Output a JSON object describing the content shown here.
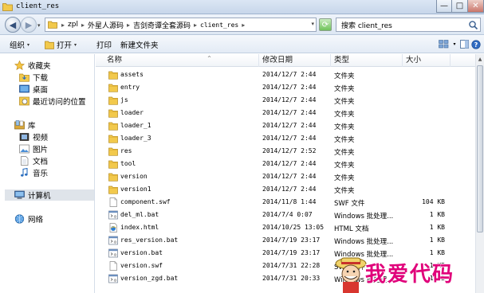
{
  "window": {
    "title": "client_res",
    "minimize": "—",
    "maximize": "□",
    "close": "✕"
  },
  "address": {
    "back": "◀",
    "forward": "▶",
    "crumbs": [
      "zpl",
      "外星人源码",
      "吉剑奇谭全套源码",
      "client_res"
    ],
    "separator": "▸",
    "dropdown": "▾",
    "refresh": "⟳"
  },
  "search": {
    "value": "搜索 client_res"
  },
  "toolbar": {
    "organize": "组织",
    "open": "打开",
    "print": "打印",
    "new_folder": "新建文件夹",
    "dropdown": "▾"
  },
  "sidebar": {
    "favorites": "收藏夹",
    "downloads": "下载",
    "desktop": "桌面",
    "recent": "最近访问的位置",
    "libraries": "库",
    "videos": "视频",
    "pictures": "图片",
    "documents": "文档",
    "music": "音乐",
    "computer": "计算机",
    "network": "网络"
  },
  "columns": {
    "name": "名称",
    "sort": "^",
    "date": "修改日期",
    "type": "类型",
    "size": "大小"
  },
  "files": [
    {
      "name": "assets",
      "date": "2014/12/7 2:44",
      "type": "文件夹",
      "size": "",
      "icon": "folder-icon"
    },
    {
      "name": "entry",
      "date": "2014/12/7 2:44",
      "type": "文件夹",
      "size": "",
      "icon": "folder-icon"
    },
    {
      "name": "js",
      "date": "2014/12/7 2:44",
      "type": "文件夹",
      "size": "",
      "icon": "folder-icon"
    },
    {
      "name": "loader",
      "date": "2014/12/7 2:44",
      "type": "文件夹",
      "size": "",
      "icon": "folder-icon"
    },
    {
      "name": "loader_1",
      "date": "2014/12/7 2:44",
      "type": "文件夹",
      "size": "",
      "icon": "folder-icon"
    },
    {
      "name": "loader_3",
      "date": "2014/12/7 2:44",
      "type": "文件夹",
      "size": "",
      "icon": "folder-icon"
    },
    {
      "name": "res",
      "date": "2014/12/7 2:52",
      "type": "文件夹",
      "size": "",
      "icon": "folder-icon"
    },
    {
      "name": "tool",
      "date": "2014/12/7 2:44",
      "type": "文件夹",
      "size": "",
      "icon": "folder-icon"
    },
    {
      "name": "version",
      "date": "2014/12/7 2:44",
      "type": "文件夹",
      "size": "",
      "icon": "folder-icon"
    },
    {
      "name": "version1",
      "date": "2014/12/7 2:44",
      "type": "文件夹",
      "size": "",
      "icon": "folder-icon"
    },
    {
      "name": "component.swf",
      "date": "2014/11/8 1:44",
      "type": "SWF 文件",
      "size": "104 KB",
      "icon": "swf-file-icon"
    },
    {
      "name": "del_ml.bat",
      "date": "2014/7/4 0:07",
      "type": "Windows 批处理...",
      "size": "1 KB",
      "icon": "bat-file-icon"
    },
    {
      "name": "index.html",
      "date": "2014/10/25 13:05",
      "type": "HTML 文档",
      "size": "1 KB",
      "icon": "html-file-icon"
    },
    {
      "name": "res_version.bat",
      "date": "2014/7/19 23:17",
      "type": "Windows 批处理...",
      "size": "1 KB",
      "icon": "bat-file-icon"
    },
    {
      "name": "version.bat",
      "date": "2014/7/19 23:17",
      "type": "Windows 批处理...",
      "size": "1 KB",
      "icon": "bat-file-icon"
    },
    {
      "name": "version.swf",
      "date": "2014/7/31 22:28",
      "type": "SWF 文件",
      "size": "1 KB",
      "icon": "swf-file-icon"
    },
    {
      "name": "version_zgd.bat",
      "date": "2014/7/31 20:33",
      "type": "Windows 批处理...",
      "size": "1 KB",
      "icon": "bat-file-icon"
    }
  ],
  "watermark": {
    "text": "我爱代码"
  },
  "colors": {
    "folder": "#f2c94c",
    "accent": "#3a74c5",
    "watermark": "#e0007a"
  }
}
